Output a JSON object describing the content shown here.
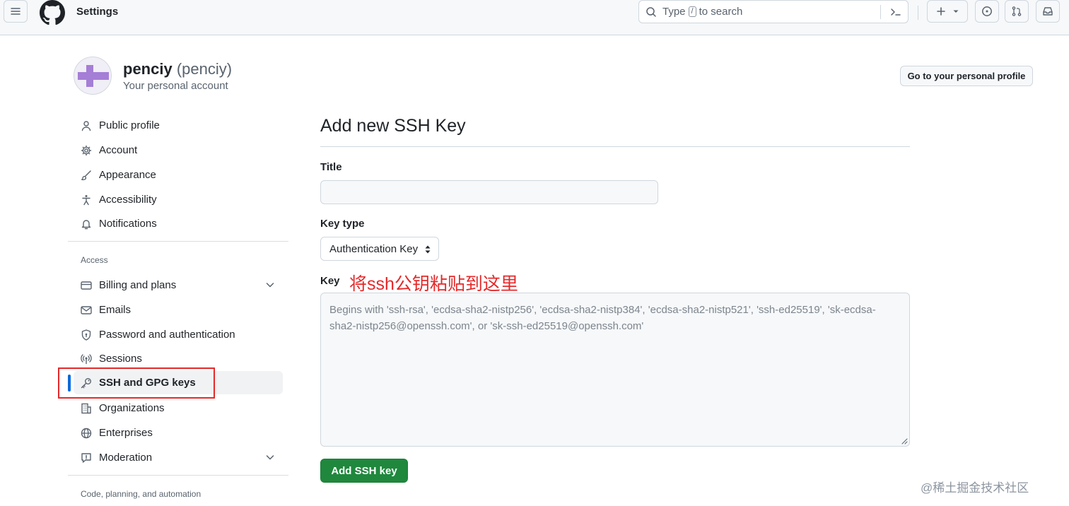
{
  "header": {
    "title": "Settings",
    "search_prefix": "Type",
    "search_slash": "/",
    "search_suffix": "to search",
    "icons": [
      "hamburger-icon",
      "github-logo",
      "search-icon",
      "command-palette-icon",
      "plus-icon",
      "issue-icon",
      "pull-request-icon",
      "inbox-icon"
    ]
  },
  "profile": {
    "display_name": "penciy",
    "login": "(penciy)",
    "subtitle": "Your personal account",
    "profile_button": "Go to your personal profile",
    "avatar_colors": {
      "fg": "#a57ed6",
      "bg": "#f0eef6"
    }
  },
  "sidebar": {
    "top_items": [
      {
        "label": "Public profile",
        "icon": "person-icon"
      },
      {
        "label": "Account",
        "icon": "gear-icon"
      },
      {
        "label": "Appearance",
        "icon": "paintbrush-icon"
      },
      {
        "label": "Accessibility",
        "icon": "accessibility-icon"
      },
      {
        "label": "Notifications",
        "icon": "bell-icon"
      }
    ],
    "access_label": "Access",
    "access_items": [
      {
        "label": "Billing and plans",
        "icon": "credit-card-icon",
        "expandable": true
      },
      {
        "label": "Emails",
        "icon": "mail-icon"
      },
      {
        "label": "Password and authentication",
        "icon": "shield-lock-icon"
      },
      {
        "label": "Sessions",
        "icon": "broadcast-icon"
      },
      {
        "label": "SSH and GPG keys",
        "icon": "key-icon",
        "active": true
      },
      {
        "label": "Organizations",
        "icon": "organization-icon"
      },
      {
        "label": "Enterprises",
        "icon": "globe-icon"
      },
      {
        "label": "Moderation",
        "icon": "report-icon",
        "expandable": true
      }
    ],
    "next_section_label": "Code, planning, and automation"
  },
  "form": {
    "heading": "Add new SSH Key",
    "title_label": "Title",
    "title_value": "",
    "key_type_label": "Key type",
    "key_type_value": "Authentication Key",
    "key_label": "Key",
    "annotation": "将ssh公钥粘贴到这里",
    "key_placeholder": "Begins with 'ssh-rsa', 'ecdsa-sha2-nistp256', 'ecdsa-sha2-nistp384', 'ecdsa-sha2-nistp521', 'ssh-ed25519', 'sk-ecdsa-sha2-nistp256@openssh.com', or 'sk-ssh-ed25519@openssh.com'",
    "submit_label": "Add SSH key"
  },
  "watermark": "@稀土掘金技术社区",
  "colors": {
    "accent_blue": "#0969da",
    "primary_green": "#1f883d",
    "annotation_red": "#e5292a",
    "muted_text": "#59636e"
  }
}
